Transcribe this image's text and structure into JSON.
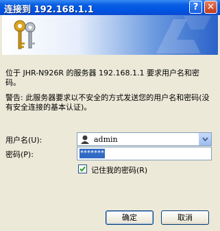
{
  "window": {
    "title": "连接到 192.168.1.1"
  },
  "titlebar": {
    "help_glyph": "?",
    "close_glyph": "✕"
  },
  "message": {
    "line1": "位于 JHR-N926R 的服务器 192.168.1.1 要求用户名和密码。",
    "warning": "警告: 此服务器要求以不安全的方式发送您的用户名和密码(没有安全连接的基本认证)。"
  },
  "username": {
    "label": "用户名(U):",
    "value": "admin"
  },
  "password": {
    "label": "密码(P):",
    "value": "*******"
  },
  "remember": {
    "label": "记住我的密码(R)",
    "checked": true,
    "check_glyph": "✓"
  },
  "buttons": {
    "ok": "确定",
    "cancel": "取消"
  },
  "colors": {
    "title_bar": "#0054e3",
    "selection": "#316ac5",
    "face": "#ece9d8"
  }
}
